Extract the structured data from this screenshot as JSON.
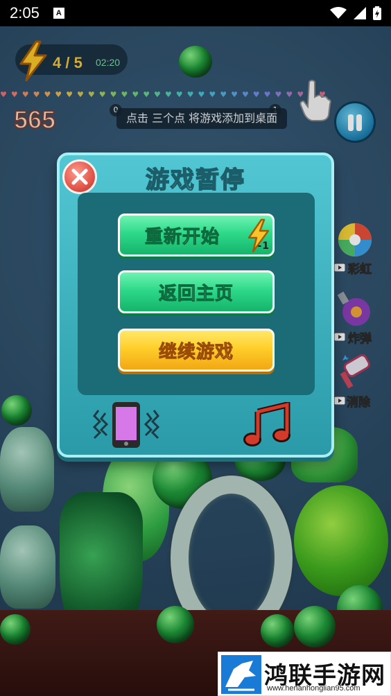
{
  "status_bar": {
    "time": "2:05",
    "sim_label": "A"
  },
  "hud": {
    "energy_count": "4 / 5",
    "energy_timer": "02:20",
    "hearts": "♥♥♥♥♥♥♥♥♥♥♥♥♥♥♥♥♥♥♥♥♥♥♥♥♥♥♥♥♥♥",
    "score": "565",
    "hint_text": "点击 三个点 将游戏添加到桌面",
    "counter_left": "0",
    "counter_right": "1"
  },
  "side_tools": [
    {
      "label": "彩虹",
      "icon": "rainbow-icon"
    },
    {
      "label": "炸弹",
      "icon": "bomb-icon"
    },
    {
      "label": "消除",
      "icon": "hammer-icon"
    }
  ],
  "pause_dialog": {
    "title": "游戏暂停",
    "restart_label": "重新开始",
    "restart_cost": "-1",
    "home_label": "返回主页",
    "continue_label": "继续游戏"
  },
  "watermark": {
    "brand": "鸿联手游网",
    "url": "www.henanhonglian95.com"
  },
  "colors": {
    "dialog_bg": "#3fb4c2",
    "green_button": "#2ed98a",
    "yellow_button": "#ffcf2b",
    "close_button": "#e2564a"
  }
}
